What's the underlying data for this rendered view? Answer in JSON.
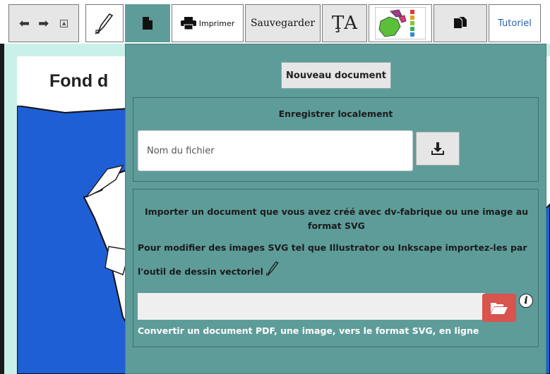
{
  "toolbar": {
    "print_label": "Imprimer",
    "save_label": "Sauvegarder",
    "text_tool_label": "ŢA",
    "tutorial_label": "Tutoriel"
  },
  "page": {
    "title": "Fond d"
  },
  "panel": {
    "new_document": "Nouveau document",
    "save_section_title": "Enregistrer localement",
    "filename_placeholder": "Nom du fichier",
    "import_text": "Importer un document que vous avez créé avec dv-fabrique ou une image au format SVG",
    "modify_text": "Pour modifier des images SVG tel que Illustrator ou Inkscape importez-les par",
    "vector_tool_text": "l'outil de dessin vectoriel",
    "file_input_value": "",
    "convert_link": "Convertir un document PDF, une image, vers le format SVG, en ligne"
  },
  "colors": {
    "panel_bg": "#5e9c9a",
    "map_blue": "#1f5fd6",
    "folder_button": "#d9534f",
    "canvas_border": "#c9f1ea"
  },
  "icons": [
    "undo-icon",
    "redo-icon",
    "pen-tool-icon",
    "file-icon",
    "printer-icon",
    "text-size-icon",
    "map-thumbnail-icon",
    "copy-icon",
    "download-icon",
    "folder-open-icon",
    "info-icon"
  ]
}
